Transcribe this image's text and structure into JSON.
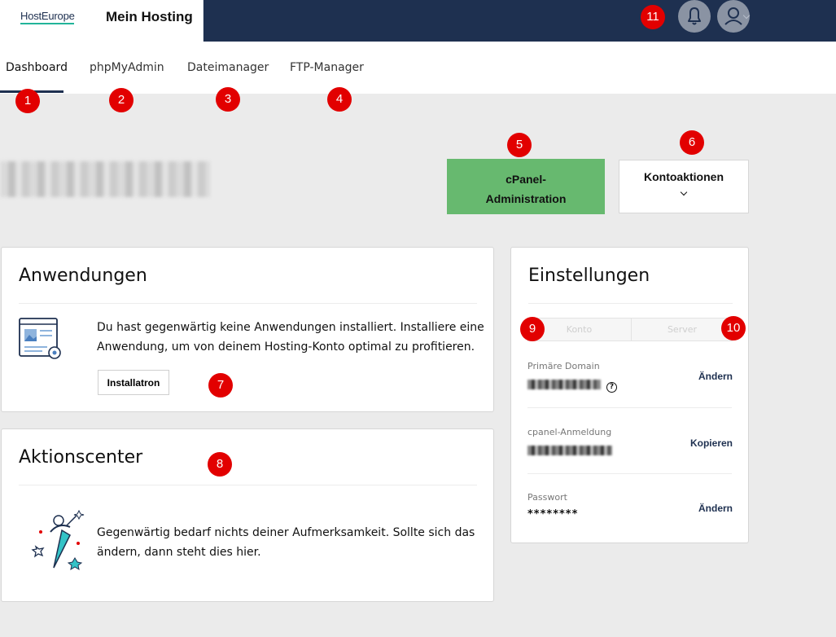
{
  "header": {
    "logo": "HostEurope",
    "title": "Mein Hosting",
    "bell_icon": "bell-icon",
    "user_icon": "user-icon"
  },
  "tabs": [
    {
      "label": "Dashboard",
      "active": true
    },
    {
      "label": "phpMyAdmin"
    },
    {
      "label": "Dateimanager"
    },
    {
      "label": "FTP-Manager"
    }
  ],
  "badges": [
    "1",
    "2",
    "3",
    "4",
    "5",
    "6",
    "7",
    "8",
    "9",
    "10",
    "11"
  ],
  "buttons": {
    "cpanel_line1": "cPanel-",
    "cpanel_line2": "Administration",
    "konto": "Kontoaktionen"
  },
  "apps": {
    "title": "Anwendungen",
    "text_line1": "Du hast gegenwärtig keine Anwendungen installiert. Installiere eine",
    "text_line2": "Anwendung, um von deinem Hosting-Konto optimal zu profitieren.",
    "button": "Installatron"
  },
  "actions": {
    "title": "Aktionscenter",
    "text_line1": "Gegenwärtig bedarf nichts deiner Aufmerksamkeit. Sollte sich das",
    "text_line2": "ändern, dann steht dies hier."
  },
  "settings": {
    "title": "Einstellungen",
    "seg_left": "Konto",
    "seg_right": "Server",
    "fields": [
      {
        "label": "Primäre Domain",
        "action": "Ändern"
      },
      {
        "label": "cpanel-Anmeldung",
        "action": "Kopieren"
      },
      {
        "label": "Passwort",
        "value": "********",
        "action": "Ändern"
      }
    ],
    "help_glyph": "?"
  },
  "colors": {
    "header_bg": "#1e3050",
    "accent_green": "#67b96f",
    "badge_red": "#e20000",
    "logo_underline": "#22b49a"
  }
}
